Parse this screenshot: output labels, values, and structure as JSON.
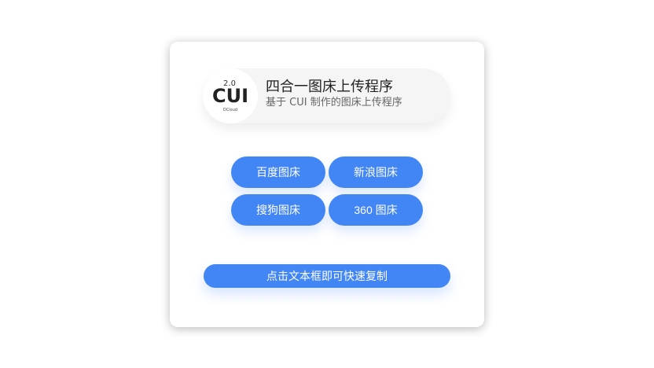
{
  "header": {
    "logo_text": "CUI",
    "logo_version": "2.0",
    "logo_caption": "DCloud",
    "title": "四合一图床上传程序",
    "subtitle": "基于 CUI 制作的图床上传程序"
  },
  "hosts": [
    {
      "label": "百度图床"
    },
    {
      "label": "新浪图床"
    },
    {
      "label": "搜狗图床"
    },
    {
      "label": "360 图床"
    }
  ],
  "copy_button": {
    "label": "点击文本框即可快速复制"
  },
  "colors": {
    "accent": "#4285f4",
    "pill": "#f5f5f5"
  }
}
